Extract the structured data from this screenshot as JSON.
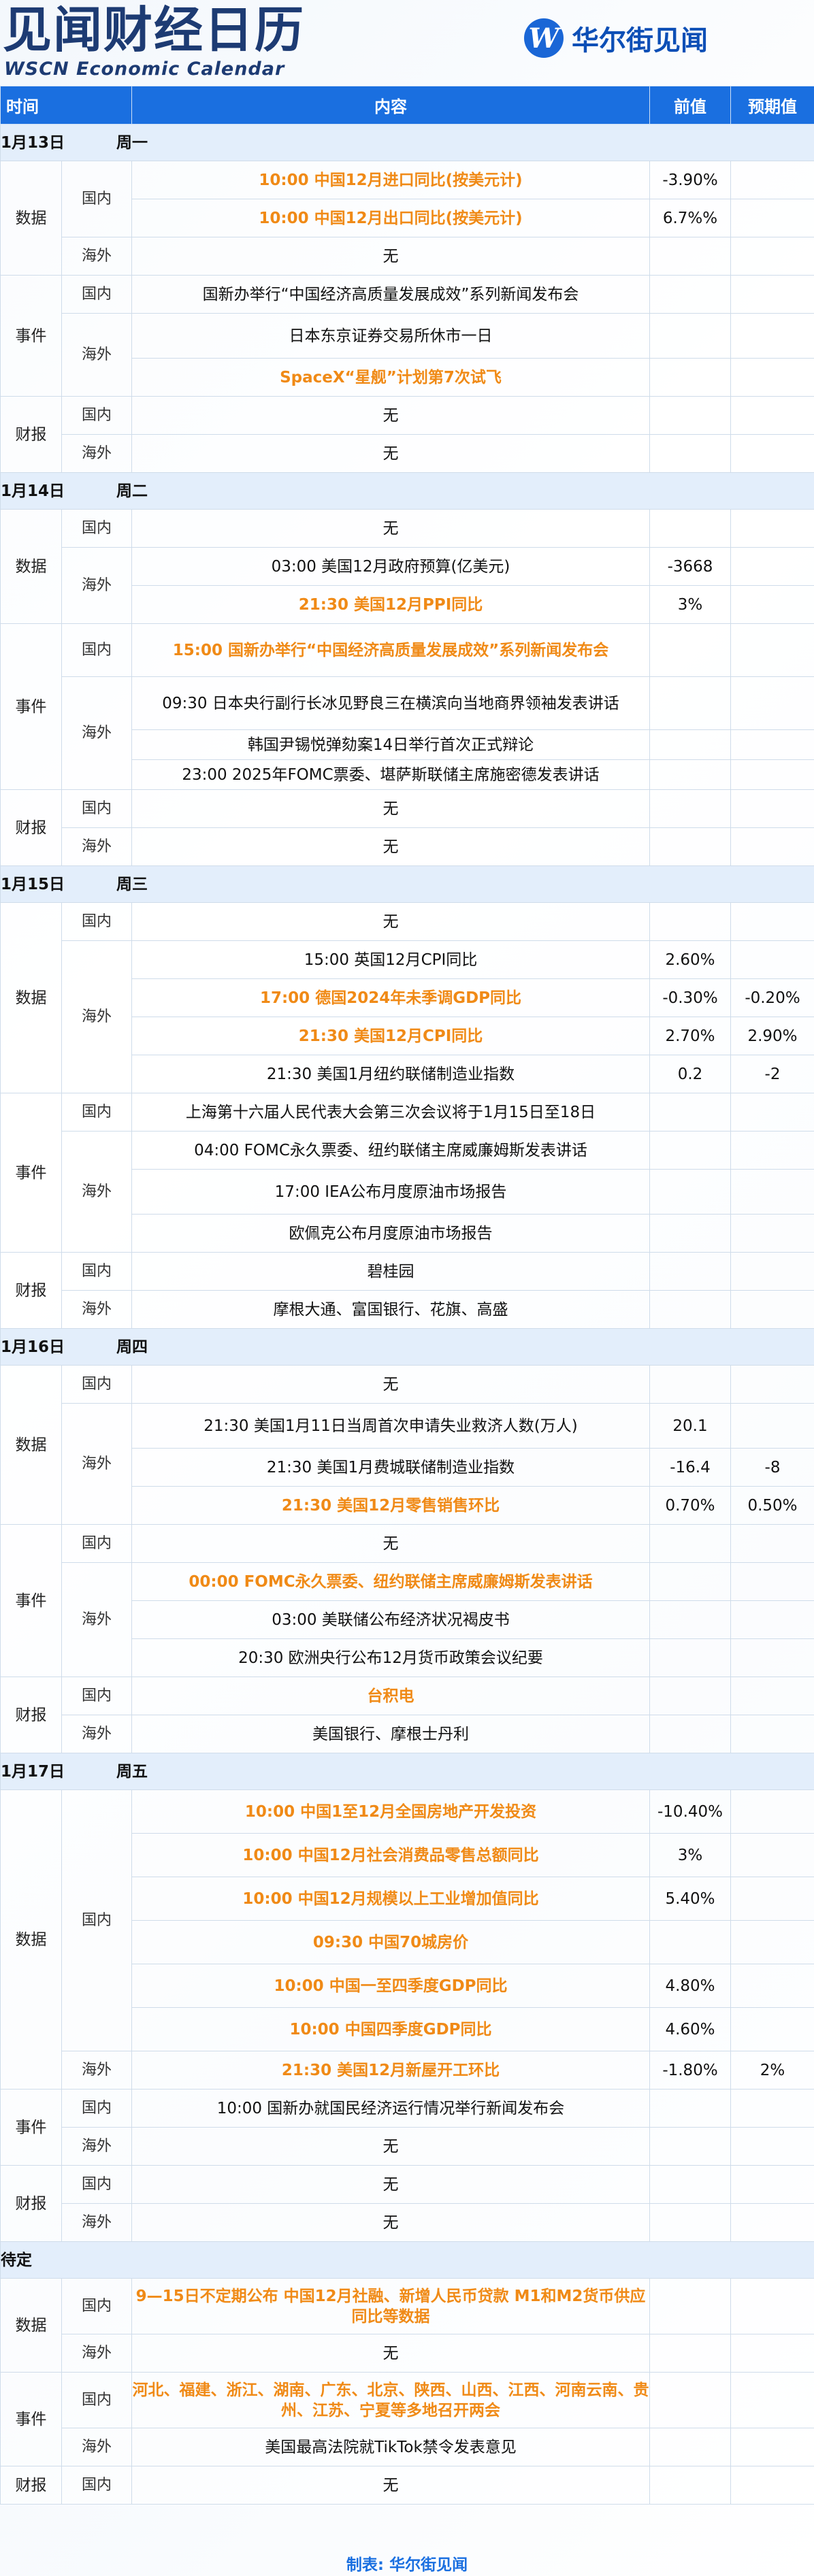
{
  "header": {
    "title_cn": "见闻财经日历",
    "title_en": "WSCN Economic Calendar",
    "logo_mark": "W",
    "logo_text": "华尔街见闻"
  },
  "columns": [
    "时间",
    "内容",
    "前值",
    "预期值"
  ],
  "days": [
    {
      "date": "1月13日",
      "weekday": "周一",
      "groups": [
        {
          "category": "数据",
          "regions": [
            {
              "region": "国内",
              "items": [
                {
                  "text": "10:00 中国12月进口同比(按美元计)",
                  "prev": "-3.90%",
                  "exp": "",
                  "hl": true,
                  "h": 56
                },
                {
                  "text": "10:00 中国12月出口同比(按美元计)",
                  "prev": "6.7%%",
                  "exp": "",
                  "hl": true,
                  "h": 56
                }
              ]
            },
            {
              "region": "海外",
              "items": [
                {
                  "text": "无",
                  "prev": "",
                  "exp": "",
                  "hl": false,
                  "h": 56
                }
              ]
            }
          ]
        },
        {
          "category": "事件",
          "regions": [
            {
              "region": "国内",
              "items": [
                {
                  "text": "国新办举行“中国经济高质量发展成效”系列新闻发布会",
                  "prev": "",
                  "exp": "",
                  "hl": false,
                  "h": 56
                }
              ]
            },
            {
              "region": "海外",
              "items": [
                {
                  "text": "日本东京证券交易所休市一日",
                  "prev": "",
                  "exp": "",
                  "hl": false,
                  "h": 66
                },
                {
                  "text": "SpaceX“星舰”计划第7次试飞",
                  "prev": "",
                  "exp": "",
                  "hl": true,
                  "h": 56
                }
              ]
            }
          ]
        },
        {
          "category": "财报",
          "regions": [
            {
              "region": "国内",
              "items": [
                {
                  "text": "无",
                  "prev": "",
                  "exp": "",
                  "hl": false,
                  "h": 56
                }
              ]
            },
            {
              "region": "海外",
              "items": [
                {
                  "text": "无",
                  "prev": "",
                  "exp": "",
                  "hl": false,
                  "h": 56
                }
              ]
            }
          ]
        }
      ]
    },
    {
      "date": "1月14日",
      "weekday": "周二",
      "groups": [
        {
          "category": "数据",
          "regions": [
            {
              "region": "国内",
              "items": [
                {
                  "text": "无",
                  "prev": "",
                  "exp": "",
                  "hl": false,
                  "h": 56
                }
              ]
            },
            {
              "region": "海外",
              "items": [
                {
                  "text": "03:00 美国12月政府预算(亿美元)",
                  "prev": "-3668",
                  "exp": "",
                  "hl": false,
                  "h": 56
                },
                {
                  "text": "21:30 美国12月PPI同比",
                  "prev": "3%",
                  "exp": "",
                  "hl": true,
                  "h": 56
                }
              ]
            }
          ]
        },
        {
          "category": "事件",
          "regions": [
            {
              "region": "国内",
              "items": [
                {
                  "text": "15:00 国新办举行“中国经济高质量发展成效”系列新闻发布会",
                  "prev": "",
                  "exp": "",
                  "hl": true,
                  "h": 78
                }
              ]
            },
            {
              "region": "海外",
              "items": [
                {
                  "text": "09:30 日本央行副行长冰见野良三在横滨向当地商界领袖发表讲话",
                  "prev": "",
                  "exp": "",
                  "hl": false,
                  "h": 78
                },
                {
                  "text": "韩国尹锡悦弹劾案14日举行首次正式辩论",
                  "prev": "",
                  "exp": "",
                  "hl": false,
                  "h": 44
                },
                {
                  "text": "23:00 2025年FOMC票委、堪萨斯联储主席施密德发表讲话",
                  "prev": "",
                  "exp": "",
                  "hl": false,
                  "h": 44
                }
              ]
            }
          ]
        },
        {
          "category": "财报",
          "regions": [
            {
              "region": "国内",
              "items": [
                {
                  "text": "无",
                  "prev": "",
                  "exp": "",
                  "hl": false,
                  "h": 56
                }
              ]
            },
            {
              "region": "海外",
              "items": [
                {
                  "text": "无",
                  "prev": "",
                  "exp": "",
                  "hl": false,
                  "h": 56
                }
              ]
            }
          ]
        }
      ]
    },
    {
      "date": "1月15日",
      "weekday": "周三",
      "groups": [
        {
          "category": "数据",
          "regions": [
            {
              "region": "国内",
              "items": [
                {
                  "text": "无",
                  "prev": "",
                  "exp": "",
                  "hl": false,
                  "h": 56
                }
              ]
            },
            {
              "region": "海外",
              "items": [
                {
                  "text": "15:00 英国12月CPI同比",
                  "prev": "2.60%",
                  "exp": "",
                  "hl": false,
                  "h": 56
                },
                {
                  "text": "17:00 德国2024年未季调GDP同比",
                  "prev": "-0.30%",
                  "exp": "-0.20%",
                  "hl": true,
                  "h": 56
                },
                {
                  "text": "21:30 美国12月CPI同比",
                  "prev": "2.70%",
                  "exp": "2.90%",
                  "hl": true,
                  "h": 56
                },
                {
                  "text": "21:30 美国1月纽约联储制造业指数",
                  "prev": "0.2",
                  "exp": "-2",
                  "hl": false,
                  "h": 56
                }
              ]
            }
          ]
        },
        {
          "category": "事件",
          "regions": [
            {
              "region": "国内",
              "items": [
                {
                  "text": "上海第十六届人民代表大会第三次会议将于1月15日至18日",
                  "prev": "",
                  "exp": "",
                  "hl": false,
                  "h": 56
                }
              ]
            },
            {
              "region": "海外",
              "items": [
                {
                  "text": "04:00 FOMC永久票委、纽约联储主席威廉姆斯发表讲话",
                  "prev": "",
                  "exp": "",
                  "hl": false,
                  "h": 56
                },
                {
                  "text": "17:00 IEA公布月度原油市场报告",
                  "prev": "",
                  "exp": "",
                  "hl": false,
                  "h": 66
                },
                {
                  "text": "欧佩克公布月度原油市场报告",
                  "prev": "",
                  "exp": "",
                  "hl": false,
                  "h": 56
                }
              ]
            }
          ]
        },
        {
          "category": "财报",
          "regions": [
            {
              "region": "国内",
              "items": [
                {
                  "text": "碧桂园",
                  "prev": "",
                  "exp": "",
                  "hl": false,
                  "h": 56
                }
              ]
            },
            {
              "region": "海外",
              "items": [
                {
                  "text": "摩根大通、富国银行、花旗、高盛",
                  "prev": "",
                  "exp": "",
                  "hl": false,
                  "h": 56
                }
              ]
            }
          ]
        }
      ]
    },
    {
      "date": "1月16日",
      "weekday": "周四",
      "groups": [
        {
          "category": "数据",
          "regions": [
            {
              "region": "国内",
              "items": [
                {
                  "text": "无",
                  "prev": "",
                  "exp": "",
                  "hl": false,
                  "h": 56
                }
              ]
            },
            {
              "region": "海外",
              "items": [
                {
                  "text": "21:30 美国1月11日当周首次申请失业救济人数(万人)",
                  "prev": "20.1",
                  "exp": "",
                  "hl": false,
                  "h": 66
                },
                {
                  "text": "21:30 美国1月费城联储制造业指数",
                  "prev": "-16.4",
                  "exp": "-8",
                  "hl": false,
                  "h": 56
                },
                {
                  "text": "21:30 美国12月零售销售环比",
                  "prev": "0.70%",
                  "exp": "0.50%",
                  "hl": true,
                  "h": 56
                }
              ]
            }
          ]
        },
        {
          "category": "事件",
          "regions": [
            {
              "region": "国内",
              "items": [
                {
                  "text": "无",
                  "prev": "",
                  "exp": "",
                  "hl": false,
                  "h": 56
                }
              ]
            },
            {
              "region": "海外",
              "items": [
                {
                  "text": "00:00 FOMC永久票委、纽约联储主席威廉姆斯发表讲话",
                  "prev": "",
                  "exp": "",
                  "hl": true,
                  "h": 56
                },
                {
                  "text": "03:00 美联储公布经济状况褐皮书",
                  "prev": "",
                  "exp": "",
                  "hl": false,
                  "h": 56
                },
                {
                  "text": "20:30 欧洲央行公布12月货币政策会议纪要",
                  "prev": "",
                  "exp": "",
                  "hl": false,
                  "h": 56
                }
              ]
            }
          ]
        },
        {
          "category": "财报",
          "regions": [
            {
              "region": "国内",
              "items": [
                {
                  "text": "台积电",
                  "prev": "",
                  "exp": "",
                  "hl": true,
                  "h": 56
                }
              ]
            },
            {
              "region": "海外",
              "items": [
                {
                  "text": "美国银行、摩根士丹利",
                  "prev": "",
                  "exp": "",
                  "hl": false,
                  "h": 56
                }
              ]
            }
          ]
        }
      ]
    },
    {
      "date": "1月17日",
      "weekday": "周五",
      "groups": [
        {
          "category": "数据",
          "regions": [
            {
              "region": "国内",
              "items": [
                {
                  "text": "10:00 中国1至12月全国房地产开发投资",
                  "prev": "-10.40%",
                  "exp": "",
                  "hl": true,
                  "h": 64
                },
                {
                  "text": "10:00 中国12月社会消费品零售总额同比",
                  "prev": "3%",
                  "exp": "",
                  "hl": true,
                  "h": 64
                },
                {
                  "text": "10:00 中国12月规模以上工业增加值同比",
                  "prev": "5.40%",
                  "exp": "",
                  "hl": true,
                  "h": 64
                },
                {
                  "text": "09:30 中国70城房价",
                  "prev": "",
                  "exp": "",
                  "hl": true,
                  "h": 64
                },
                {
                  "text": "10:00 中国一至四季度GDP同比",
                  "prev": "4.80%",
                  "exp": "",
                  "hl": true,
                  "h": 64
                },
                {
                  "text": "10:00 中国四季度GDP同比",
                  "prev": "4.60%",
                  "exp": "",
                  "hl": true,
                  "h": 64
                }
              ]
            },
            {
              "region": "海外",
              "items": [
                {
                  "text": "21:30 美国12月新屋开工环比",
                  "prev": "-1.80%",
                  "exp": "2%",
                  "hl": true,
                  "h": 56
                }
              ]
            }
          ]
        },
        {
          "category": "事件",
          "regions": [
            {
              "region": "国内",
              "items": [
                {
                  "text": "10:00 国新办就国民经济运行情况举行新闻发布会",
                  "prev": "",
                  "exp": "",
                  "hl": false,
                  "h": 56
                }
              ]
            },
            {
              "region": "海外",
              "items": [
                {
                  "text": "无",
                  "prev": "",
                  "exp": "",
                  "hl": false,
                  "h": 56
                }
              ]
            }
          ]
        },
        {
          "category": "财报",
          "regions": [
            {
              "region": "国内",
              "items": [
                {
                  "text": "无",
                  "prev": "",
                  "exp": "",
                  "hl": false,
                  "h": 56
                }
              ]
            },
            {
              "region": "海外",
              "items": [
                {
                  "text": "无",
                  "prev": "",
                  "exp": "",
                  "hl": false,
                  "h": 56
                }
              ]
            }
          ]
        }
      ]
    },
    {
      "date": "待定",
      "weekday": "",
      "groups": [
        {
          "category": "数据",
          "regions": [
            {
              "region": "国内",
              "items": [
                {
                  "text": "9—15日不定期公布 中国12月社融、新增人民币贷款 M1和M2货币供应同比等数据",
                  "prev": "",
                  "exp": "",
                  "hl": true,
                  "h": 82
                }
              ]
            },
            {
              "region": "海外",
              "items": [
                {
                  "text": "无",
                  "prev": "",
                  "exp": "",
                  "hl": false,
                  "h": 56
                }
              ]
            }
          ]
        },
        {
          "category": "事件",
          "regions": [
            {
              "region": "国内",
              "items": [
                {
                  "text": "河北、福建、浙江、湖南、广东、北京、陕西、山西、江西、河南云南、贵州、江苏、宁夏等多地召开两会",
                  "prev": "",
                  "exp": "",
                  "hl": true,
                  "h": 82
                }
              ]
            },
            {
              "region": "海外",
              "items": [
                {
                  "text": "美国最高法院就TikTok禁令发表意见",
                  "prev": "",
                  "exp": "",
                  "hl": false,
                  "h": 56
                }
              ]
            }
          ]
        },
        {
          "category": "财报",
          "regions": [
            {
              "region": "国内",
              "items": [
                {
                  "text": "无",
                  "prev": "",
                  "exp": "",
                  "hl": false,
                  "h": 56
                }
              ]
            }
          ]
        }
      ]
    }
  ],
  "footer": "制表: 华尔街见闻"
}
